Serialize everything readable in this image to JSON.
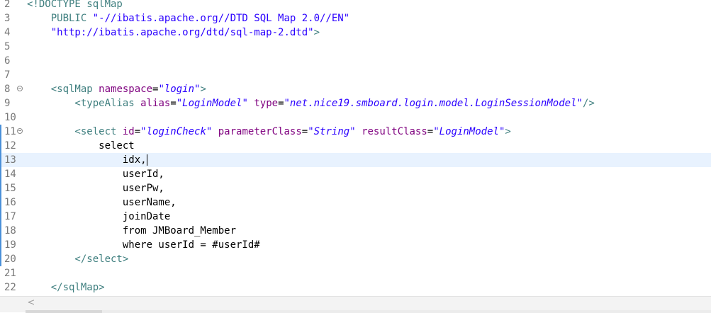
{
  "editor": {
    "lines": [
      {
        "num": "2",
        "parts": [
          {
            "t": "<!DOCTYPE sqlMap",
            "c": "dtd"
          }
        ]
      },
      {
        "num": "3",
        "parts": [
          {
            "t": "    PUBLIC ",
            "c": "dtd"
          },
          {
            "t": "\"-//ibatis.apache.org//DTD SQL Map 2.0//EN\"",
            "c": "dstr"
          }
        ]
      },
      {
        "num": "4",
        "parts": [
          {
            "t": "    ",
            "c": "txt"
          },
          {
            "t": "\"http://ibatis.apache.org/dtd/sql-map-2.dtd\"",
            "c": "dstr"
          },
          {
            "t": ">",
            "c": "dtd"
          }
        ]
      },
      {
        "num": "5",
        "parts": []
      },
      {
        "num": "6",
        "parts": []
      },
      {
        "num": "7",
        "parts": []
      },
      {
        "num": "8",
        "fold": true,
        "parts": [
          {
            "t": "    <sqlMap ",
            "c": "tag"
          },
          {
            "t": "namespace",
            "c": "attr"
          },
          {
            "t": "=",
            "c": "txt"
          },
          {
            "t": "\"login\"",
            "c": "str"
          },
          {
            "t": ">",
            "c": "tag"
          }
        ]
      },
      {
        "num": "9",
        "parts": [
          {
            "t": "        <typeAlias ",
            "c": "tag"
          },
          {
            "t": "alias",
            "c": "attr"
          },
          {
            "t": "=",
            "c": "txt"
          },
          {
            "t": "\"LoginModel\"",
            "c": "str"
          },
          {
            "t": " ",
            "c": "txt"
          },
          {
            "t": "type",
            "c": "attr"
          },
          {
            "t": "=",
            "c": "txt"
          },
          {
            "t": "\"net.nice19.smboard.login.model.LoginSessionModel\"",
            "c": "str"
          },
          {
            "t": "/>",
            "c": "tag"
          }
        ]
      },
      {
        "num": "10",
        "parts": []
      },
      {
        "num": "11",
        "fold": true,
        "bar": true,
        "parts": [
          {
            "t": "        <select ",
            "c": "tag"
          },
          {
            "t": "id",
            "c": "attr"
          },
          {
            "t": "=",
            "c": "txt"
          },
          {
            "t": "\"loginCheck\"",
            "c": "str"
          },
          {
            "t": " ",
            "c": "txt"
          },
          {
            "t": "parameterClass",
            "c": "attr"
          },
          {
            "t": "=",
            "c": "txt"
          },
          {
            "t": "\"String\"",
            "c": "str"
          },
          {
            "t": " ",
            "c": "txt"
          },
          {
            "t": "resultClass",
            "c": "attr"
          },
          {
            "t": "=",
            "c": "txt"
          },
          {
            "t": "\"LoginModel\"",
            "c": "str"
          },
          {
            "t": ">",
            "c": "tag"
          }
        ]
      },
      {
        "num": "12",
        "bar": true,
        "parts": [
          {
            "t": "            select",
            "c": "txt"
          }
        ]
      },
      {
        "num": "13",
        "bar": true,
        "current": true,
        "caret": true,
        "parts": [
          {
            "t": "                idx,",
            "c": "txt"
          }
        ]
      },
      {
        "num": "14",
        "bar": true,
        "parts": [
          {
            "t": "                userId,",
            "c": "txt"
          }
        ]
      },
      {
        "num": "15",
        "bar": true,
        "parts": [
          {
            "t": "                userPw,",
            "c": "txt"
          }
        ]
      },
      {
        "num": "16",
        "bar": true,
        "parts": [
          {
            "t": "                userName,",
            "c": "txt"
          }
        ]
      },
      {
        "num": "17",
        "bar": true,
        "parts": [
          {
            "t": "                joinDate",
            "c": "txt"
          }
        ]
      },
      {
        "num": "18",
        "bar": true,
        "parts": [
          {
            "t": "                from JMBoard_Member",
            "c": "txt"
          }
        ]
      },
      {
        "num": "19",
        "bar": true,
        "parts": [
          {
            "t": "                where userId = #userId#",
            "c": "txt"
          }
        ]
      },
      {
        "num": "20",
        "bar": true,
        "parts": [
          {
            "t": "        </select>",
            "c": "tag"
          }
        ]
      },
      {
        "num": "21",
        "parts": []
      },
      {
        "num": "22",
        "parts": [
          {
            "t": "    </sqlMap>",
            "c": "tag"
          }
        ]
      }
    ]
  },
  "scrollbar": {
    "left_arrow": "<"
  }
}
